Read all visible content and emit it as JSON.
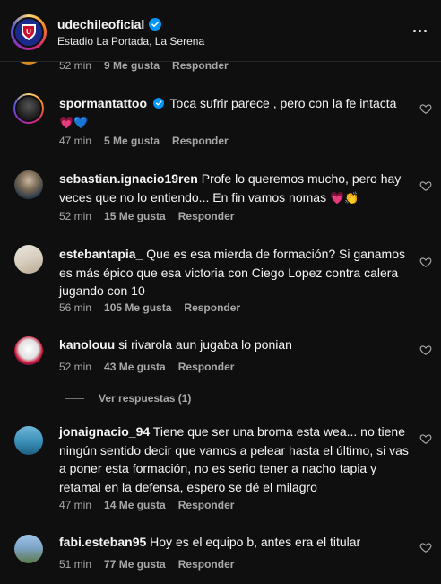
{
  "header": {
    "username": "udechileoficial",
    "location": "Estadio La Portada, La Serena"
  },
  "partial_comment": {
    "time": "52 min",
    "likes": "9 Me gusta",
    "reply": "Responder"
  },
  "comments": [
    {
      "user": "spormantattoo",
      "verified": true,
      "text": "Toca sufrir parece , pero con la fe intacta",
      "emoji_tail": "💗💙",
      "time": "47 min",
      "likes": "5 Me gusta",
      "reply": "Responder"
    },
    {
      "user": "sebastian.ignacio19ren",
      "text": "Profe lo queremos mucho, pero hay veces que no lo entiendo... En fin vamos nomas",
      "emoji_tail": "💗👏",
      "time": "52 min",
      "likes": "15 Me gusta",
      "reply": "Responder"
    },
    {
      "user": "estebantapia_",
      "text": "Que es esa mierda de formación? Si ganamos es más épico que esa victoria con Ciego Lopez contra calera jugando con 10",
      "time": "56 min",
      "likes": "105 Me gusta",
      "reply": "Responder"
    },
    {
      "user": "kanolouu",
      "text": "si rivarola aun jugaba lo ponian",
      "time": "52 min",
      "likes": "43 Me gusta",
      "reply": "Responder",
      "view_replies": "Ver respuestas (1)"
    },
    {
      "user": "jonaignacio_94",
      "text": "Tiene que ser una broma esta wea... no tiene ningún sentido decir que vamos a pelear hasta el último, si vas a poner esta formación, no es serio tener a nacho tapia y retamal en la defensa, espero se dé el milagro",
      "time": "47 min",
      "likes": "14 Me gusta",
      "reply": "Responder"
    },
    {
      "user": "fabi.esteban95",
      "text": "Hoy es el equipo b, antes era el titular",
      "time": "51 min",
      "likes": "77 Me gusta",
      "reply": "Responder"
    }
  ],
  "colors": {
    "background": "#0f0f0f",
    "secondary_text": "#a8a8a8",
    "verified_blue": "#0095f6"
  }
}
